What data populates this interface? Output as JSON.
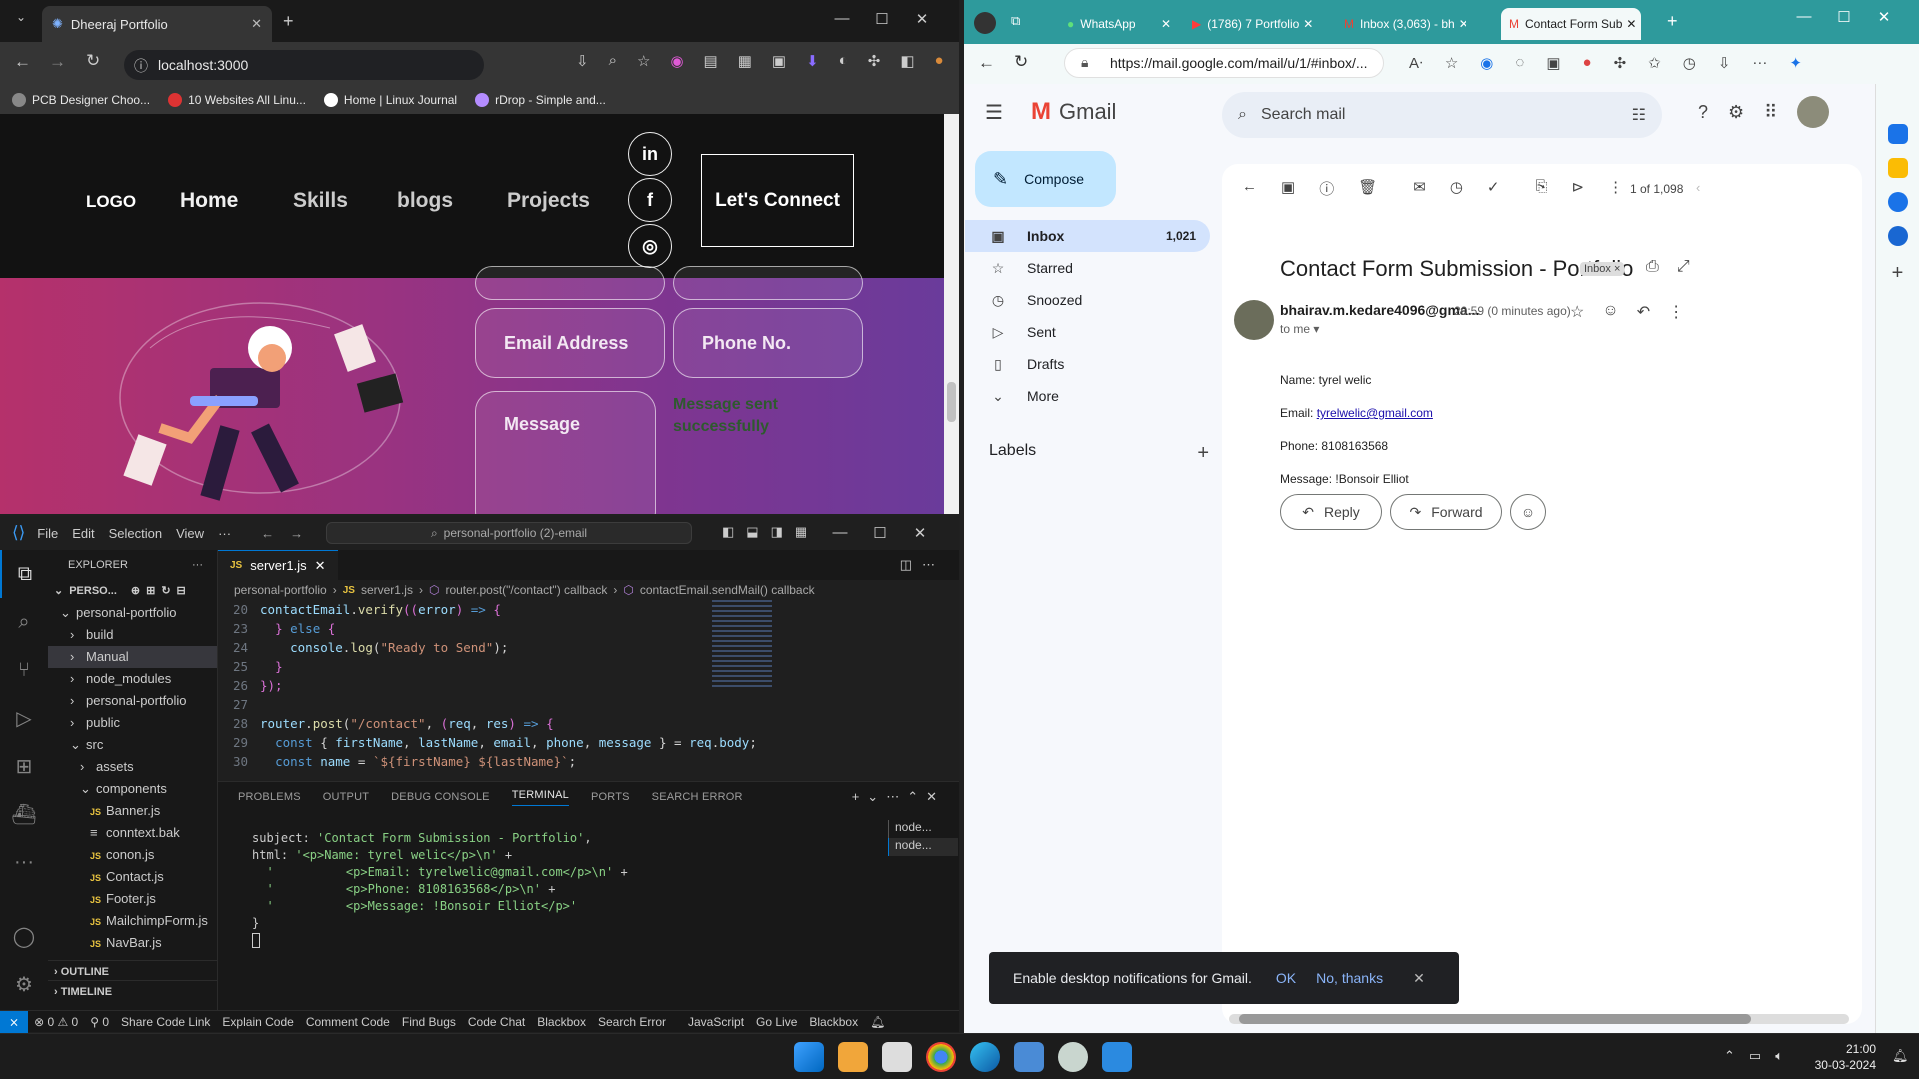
{
  "chrome": {
    "tab_title": "Dheeraj Portfolio",
    "url": "localhost:3000",
    "bookmarks": [
      "PCB Designer Choo...",
      "10 Websites All Linu...",
      "Home | Linux Journal",
      "rDrop - Simple and..."
    ]
  },
  "site": {
    "logo": "LOGO",
    "nav": [
      "Home",
      "Skills",
      "blogs",
      "Projects"
    ],
    "social": [
      "in",
      "f",
      "◎"
    ],
    "connect": "Let's Connect",
    "fields": {
      "email": "Email Address",
      "phone": "Phone No.",
      "message": "Message"
    },
    "status_msg": "Message sent successfully"
  },
  "vscode": {
    "menu": [
      "File",
      "Edit",
      "Selection",
      "View",
      "···"
    ],
    "search": "personal-portfolio (2)-email",
    "explorer_title": "EXPLORER",
    "project": "PERSO...",
    "tree": [
      {
        "label": "personal-portfolio",
        "indent": 1,
        "arrow": "⌄"
      },
      {
        "label": "build",
        "indent": 2,
        "arrow": "›"
      },
      {
        "label": "Manual",
        "indent": 2,
        "arrow": "›"
      },
      {
        "label": "node_modules",
        "indent": 2,
        "arrow": "›"
      },
      {
        "label": "personal-portfolio",
        "indent": 2,
        "arrow": "›"
      },
      {
        "label": "public",
        "indent": 2,
        "arrow": "›"
      },
      {
        "label": "src",
        "indent": 2,
        "arrow": "⌄"
      },
      {
        "label": "assets",
        "indent": 3,
        "arrow": "›"
      },
      {
        "label": "components",
        "indent": 3,
        "arrow": "⌄"
      },
      {
        "label": "Banner.js",
        "indent": 4,
        "arrow": "JS"
      },
      {
        "label": "conntext.bak",
        "indent": 4,
        "arrow": "≡"
      },
      {
        "label": "conon.js",
        "indent": 4,
        "arrow": "JS"
      },
      {
        "label": "Contact.js",
        "indent": 4,
        "arrow": "JS"
      },
      {
        "label": "Footer.js",
        "indent": 4,
        "arrow": "JS"
      },
      {
        "label": "MailchimpForm.js",
        "indent": 4,
        "arrow": "JS"
      },
      {
        "label": "NavBar.js",
        "indent": 4,
        "arrow": "JS"
      }
    ],
    "outline": "OUTLINE",
    "timeline": "TIMELINE",
    "file_tab": "server1.js",
    "breadcrumb": [
      "personal-portfolio",
      "server1.js",
      "router.post(\"/contact\") callback",
      "contactEmail.sendMail() callback"
    ],
    "panel_tabs": [
      "PROBLEMS",
      "OUTPUT",
      "DEBUG CONSOLE",
      "TERMINAL",
      "PORTS",
      "SEARCH ERROR"
    ],
    "terminals": [
      "node...",
      "node..."
    ],
    "status_items": [
      "⊗ 0 ⚠ 0",
      "⚲ 0",
      "Share Code Link",
      "Explain Code",
      "Comment Code",
      "Find Bugs",
      "Code Chat",
      "Blackbox",
      "Search Error",
      "JavaScript",
      "Go Live",
      "Blackbox"
    ]
  },
  "edge": {
    "tabs": [
      "WhatsApp",
      "(1786) 7 Portfolio",
      "Inbox (3,063) - bh",
      "Contact Form Sub"
    ],
    "url": "https://mail.google.com/mail/u/1/#inbox/..."
  },
  "gmail": {
    "brand": "Gmail",
    "search_placeholder": "Search mail",
    "compose": "Compose",
    "nav": [
      {
        "label": "Inbox",
        "count": "1,021",
        "icon": "▣"
      },
      {
        "label": "Starred",
        "count": "",
        "icon": "☆"
      },
      {
        "label": "Snoozed",
        "count": "",
        "icon": "◷"
      },
      {
        "label": "Sent",
        "count": "",
        "icon": "▷"
      },
      {
        "label": "Drafts",
        "count": "",
        "icon": "▯"
      },
      {
        "label": "More",
        "count": "",
        "icon": "⌄"
      }
    ],
    "labels_heading": "Labels",
    "pager": "1 of 1,098",
    "subject": "Contact Form Submission - Portfolio",
    "label_chip": "Inbox ×",
    "sender": "bhairav.m.kedare4096@gma...",
    "time": "20:59 (0 minutes ago)",
    "to": "to me ▾",
    "body": {
      "name": "Name: tyrel welic",
      "email_label": "Email: ",
      "email": "tyrelwelic@gmail.com",
      "phone": "Phone: 8108163568",
      "message": "Message: !Bonsoir Elliot"
    },
    "reply": "Reply",
    "forward": "Forward",
    "notify": {
      "text": "Enable desktop notifications for Gmail.",
      "ok": "OK",
      "no": "No, thanks"
    }
  },
  "taskbar": {
    "time": "21:00",
    "date": "30-03-2024"
  }
}
